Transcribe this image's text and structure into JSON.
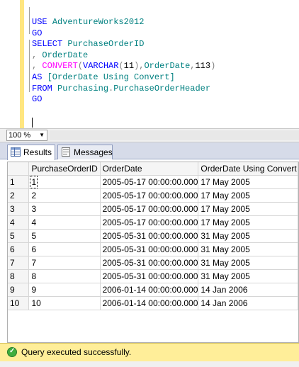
{
  "editor": {
    "lines": [
      {
        "parts": [
          {
            "c": "kw",
            "t": "USE "
          },
          {
            "c": "id",
            "t": "AdventureWorks2012"
          }
        ]
      },
      {
        "parts": [
          {
            "c": "kw",
            "t": "GO"
          }
        ]
      },
      {
        "parts": [
          {
            "c": "kw",
            "t": "SELECT "
          },
          {
            "c": "id",
            "t": "PurchaseOrderID"
          }
        ]
      },
      {
        "parts": [
          {
            "c": "op",
            "t": ", "
          },
          {
            "c": "id",
            "t": "OrderDate"
          }
        ]
      },
      {
        "parts": [
          {
            "c": "op",
            "t": ", "
          },
          {
            "c": "fn",
            "t": "CONVERT"
          },
          {
            "c": "op",
            "t": "("
          },
          {
            "c": "kw",
            "t": "VARCHAR"
          },
          {
            "c": "op",
            "t": "("
          },
          {
            "c": "num",
            "t": "11"
          },
          {
            "c": "op",
            "t": "),"
          },
          {
            "c": "id",
            "t": "OrderDate"
          },
          {
            "c": "op",
            "t": ","
          },
          {
            "c": "num",
            "t": "113"
          },
          {
            "c": "op",
            "t": ")"
          }
        ]
      },
      {
        "parts": [
          {
            "c": "kw",
            "t": "AS "
          },
          {
            "c": "id",
            "t": "[OrderDate Using Convert]"
          }
        ]
      },
      {
        "parts": [
          {
            "c": "kw",
            "t": "FROM "
          },
          {
            "c": "id",
            "t": "Purchasing"
          },
          {
            "c": "op",
            "t": "."
          },
          {
            "c": "id",
            "t": "PurchaseOrderHeader"
          }
        ]
      },
      {
        "parts": [
          {
            "c": "kw",
            "t": "GO"
          }
        ]
      }
    ]
  },
  "zoom": {
    "value": "100 %"
  },
  "tabs": [
    {
      "label": "Results",
      "active": true
    },
    {
      "label": "Messages",
      "active": false
    }
  ],
  "grid": {
    "columns": [
      "PurchaseOrderID",
      "OrderDate",
      "OrderDate Using Convert"
    ],
    "rows": [
      [
        "1",
        "1",
        "2005-05-17 00:00:00.000",
        "17 May 2005"
      ],
      [
        "2",
        "2",
        "2005-05-17 00:00:00.000",
        "17 May 2005"
      ],
      [
        "3",
        "3",
        "2005-05-17 00:00:00.000",
        "17 May 2005"
      ],
      [
        "4",
        "4",
        "2005-05-17 00:00:00.000",
        "17 May 2005"
      ],
      [
        "5",
        "5",
        "2005-05-31 00:00:00.000",
        "31 May 2005"
      ],
      [
        "6",
        "6",
        "2005-05-31 00:00:00.000",
        "31 May 2005"
      ],
      [
        "7",
        "7",
        "2005-05-31 00:00:00.000",
        "31 May 2005"
      ],
      [
        "8",
        "8",
        "2005-05-31 00:00:00.000",
        "31 May 2005"
      ],
      [
        "9",
        "9",
        "2006-01-14 00:00:00.000",
        "14 Jan 2006"
      ],
      [
        "10",
        "10",
        "2006-01-14 00:00:00.000",
        "14 Jan 2006"
      ]
    ]
  },
  "status": {
    "text": "Query executed successfully.",
    "icon": "check-circle-icon"
  }
}
